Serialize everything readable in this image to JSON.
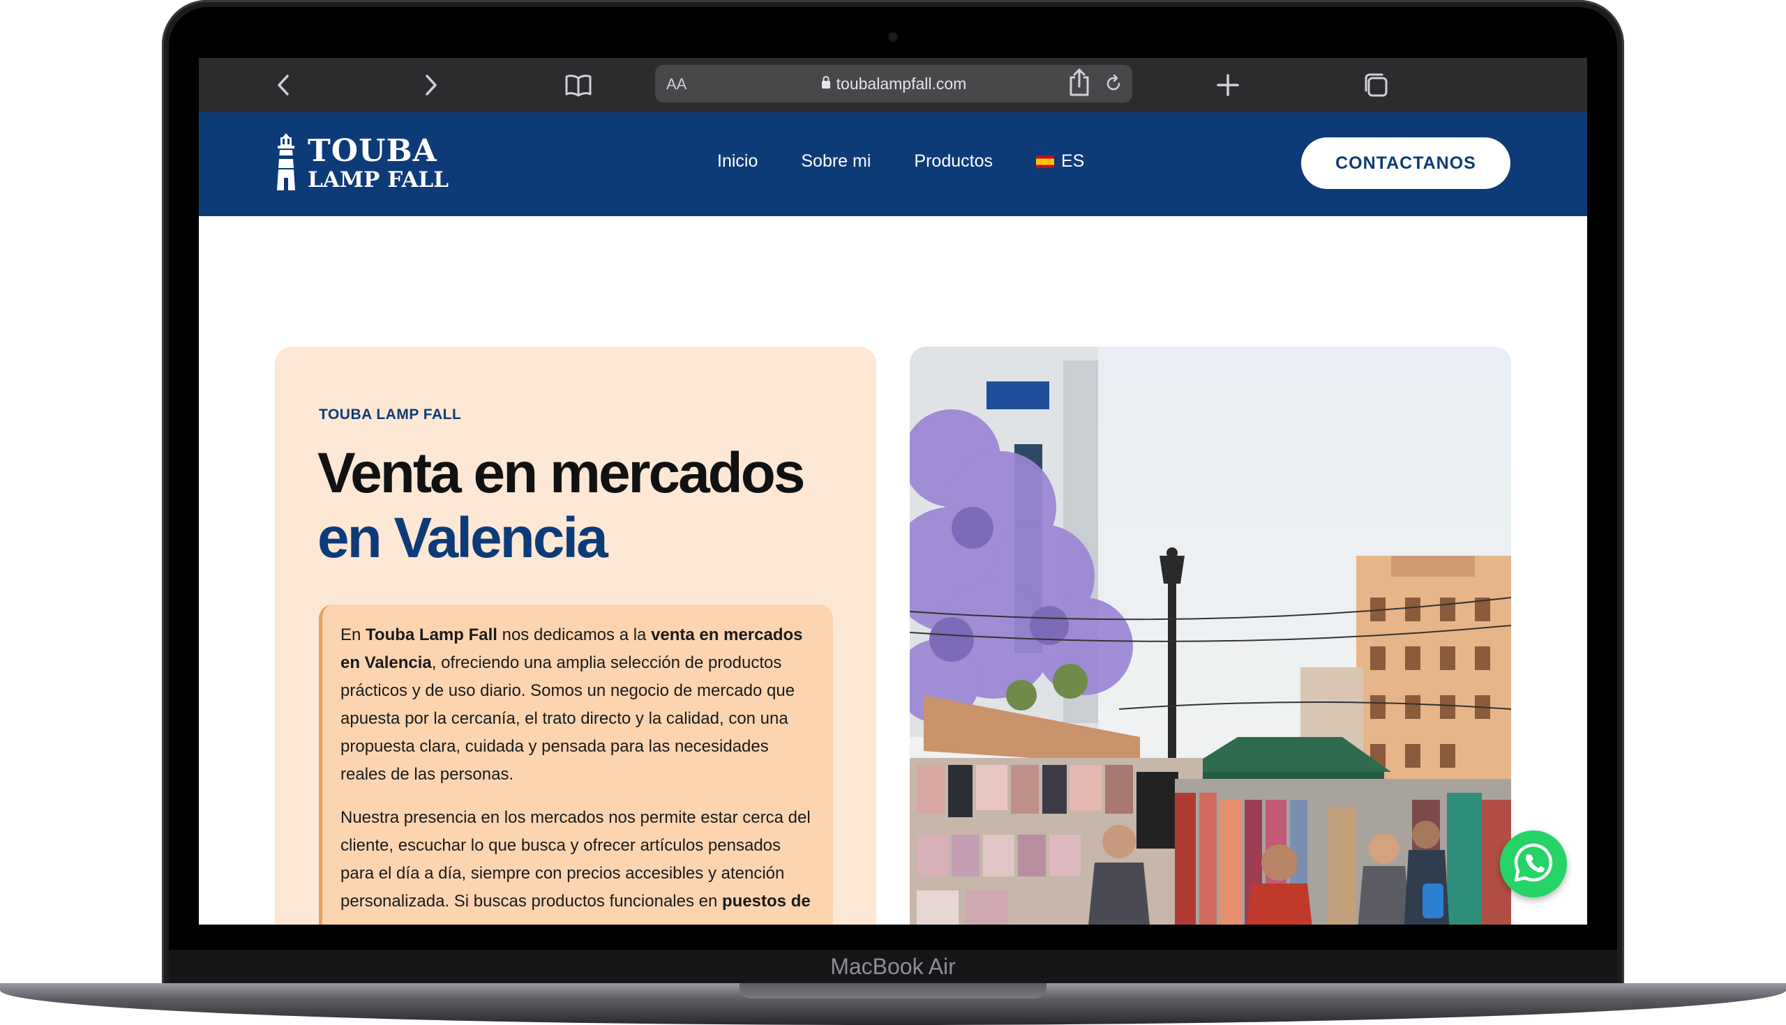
{
  "device": {
    "label": "MacBook Air"
  },
  "browser": {
    "text_size_label": "AA",
    "url": "toubalampfall.com",
    "icons": [
      "back-icon",
      "forward-icon",
      "bookmarks-icon",
      "lock-icon",
      "reload-icon",
      "share-icon",
      "new-tab-icon",
      "tabs-icon"
    ]
  },
  "site": {
    "logo": {
      "line1": "TOUBA",
      "line2": "LAMP FALL"
    },
    "nav": [
      {
        "label": "Inicio"
      },
      {
        "label": "Sobre mi"
      },
      {
        "label": "Productos"
      },
      {
        "label": "ES"
      }
    ],
    "cta": "CONTACTANOS",
    "colors": {
      "primary": "#0d3b78",
      "card_bg": "#fde8d6",
      "text_box_bg": "#fcd5b0",
      "whatsapp": "#25d366"
    }
  },
  "hero": {
    "eyebrow": "TOUBA LAMP FALL",
    "title_line1": "Venta en mercados",
    "title_line2": "en Valencia",
    "para1": {
      "t1": "En ",
      "b1": "Touba Lamp Fall",
      "t2": " nos dedicamos a la ",
      "b2": "venta en mercados en Valencia",
      "t3": ", ofreciendo una amplia selección de productos prácticos y de uso diario. Somos un negocio de mercado que apuesta por la cercanía, el trato directo y la calidad, con una propuesta clara, cuidada y pensada para las necesidades reales de las personas."
    },
    "para2": {
      "t1": "Nuestra presencia en los mercados nos permite estar cerca del cliente, escuchar lo que busca y ofrecer artículos pensados para el día a día, siempre con precios accesibles y atención personalizada. Si buscas productos funcionales en ",
      "b1": "puestos de"
    }
  }
}
